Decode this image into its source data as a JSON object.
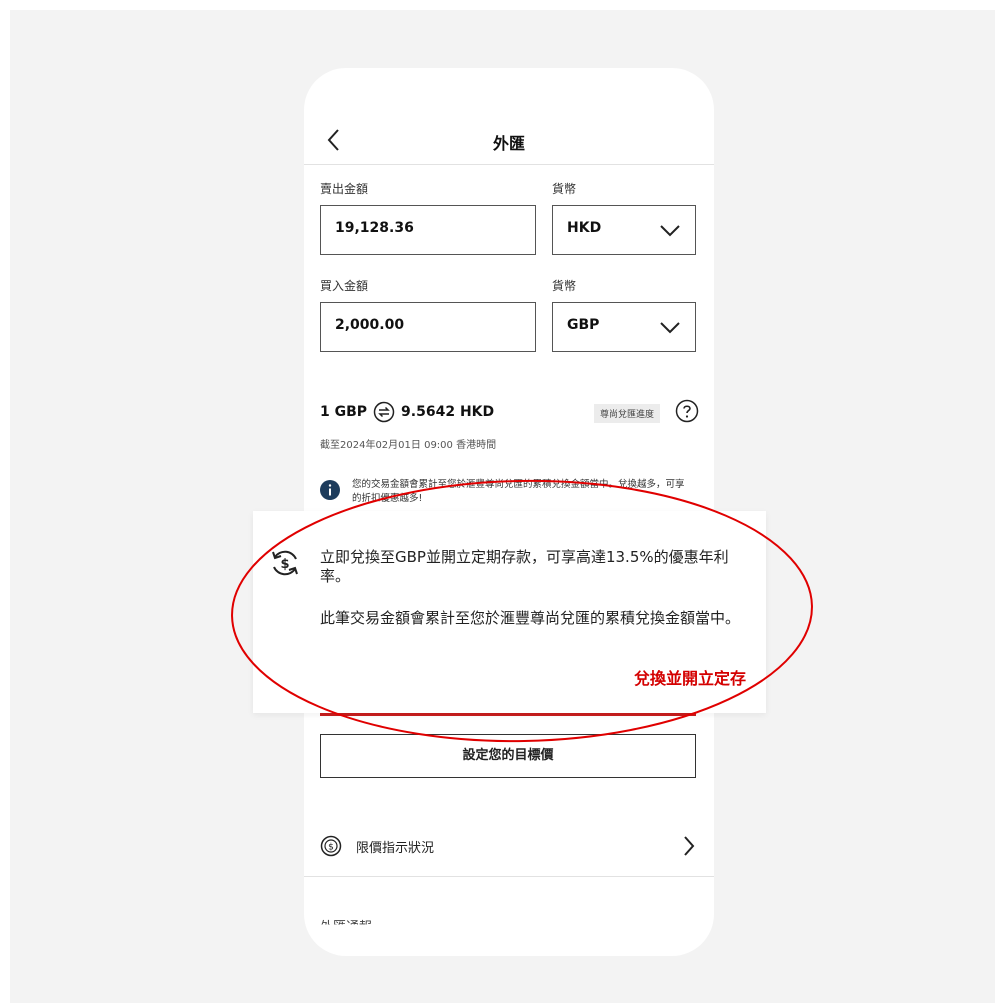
{
  "header": {
    "title": "外匯"
  },
  "sell": {
    "label": "賣出金額",
    "value": "19,128.36",
    "currency_label": "貨幣",
    "currency": "HKD"
  },
  "buy": {
    "label": "買入金額",
    "value": "2,000.00",
    "currency_label": "貨幣",
    "currency": "GBP"
  },
  "rate": {
    "from": "1 GBP",
    "to": "9.5642 HKD",
    "premium_badge": "尊尚兌匯進度"
  },
  "as_of": "截至2024年02月01日 09:00 香港時間",
  "info": {
    "text": "您的交易金額會累計至您於滙豐尊尚兌匯的累積兌換金額當中。兌換越多，可享的折扣優惠越多!"
  },
  "popup": {
    "line1": "立即兌換至GBP並開立定期存款，可享高達13.5%的優惠年利率。",
    "line2": "此筆交易金額會累計至您於滙豐尊尚兌匯的累積兌換金額當中。",
    "action": "兌換並開立定存"
  },
  "target_button": "設定您的目標價",
  "limit_row": {
    "label": "限價指示狀況"
  },
  "cut_text": "外匯通報",
  "colors": {
    "accent": "#d40000",
    "annotation": "#e00000"
  }
}
